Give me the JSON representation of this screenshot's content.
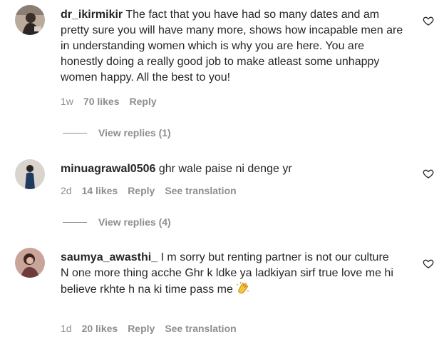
{
  "comments": [
    {
      "username": "dr_ikirmikir",
      "text": "The fact that you have had so many dates and am pretty sure you will have many more, shows how incapable men are in understanding women which is why you are here. You are honestly doing a really good job to make atleast some unhappy women happy. All the best to you!",
      "time": "1w",
      "likes": "70 likes",
      "reply": "Reply",
      "view_replies": "View replies (1)"
    },
    {
      "username": "minuagrawal0506",
      "text": "ghr wale paise ni denge yr",
      "time": "2d",
      "likes": "14 likes",
      "reply": "Reply",
      "translation": "See translation",
      "view_replies": "View replies (4)"
    },
    {
      "username": "saumya_awasthi_",
      "text": "I m sorry but renting partner is not our culture",
      "text2": "N one more thing acche Ghr k ldke ya ladkiyan sirf true love me hi believe rkhte h na ki time pass me",
      "emoji": "clapping-hands",
      "time": "1d",
      "likes": "20 likes",
      "reply": "Reply",
      "translation": "See translation"
    }
  ],
  "colors": {
    "text": "#262626",
    "muted": "#8e8e8e",
    "background": "#ffffff"
  }
}
